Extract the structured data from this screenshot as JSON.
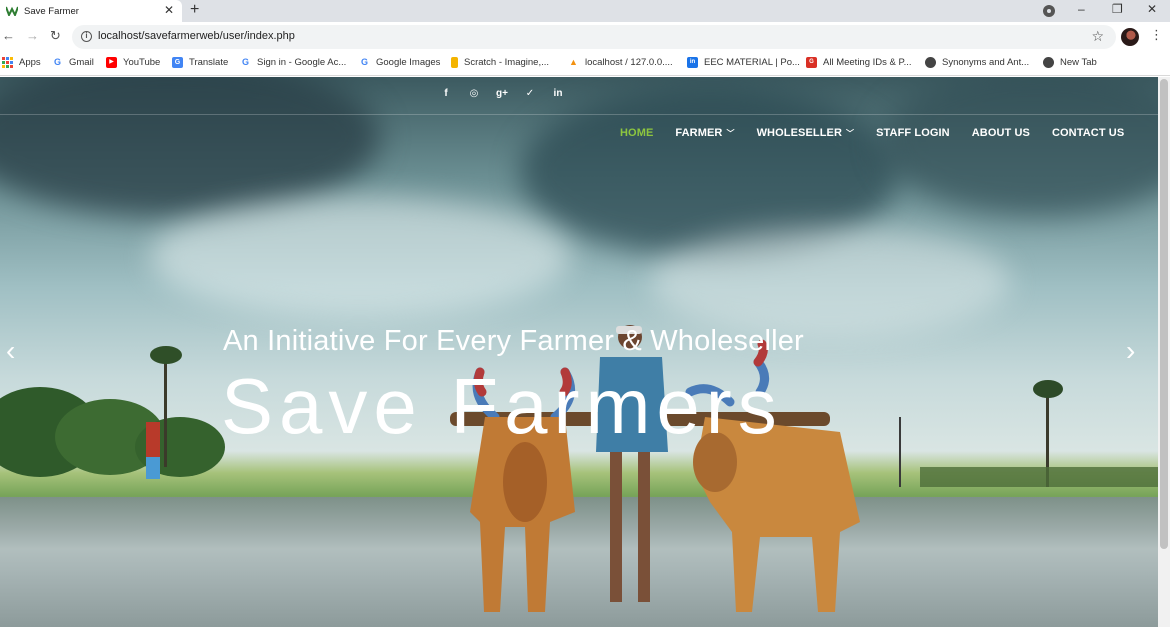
{
  "browser": {
    "tab_title": "Save Farmer",
    "url": "localhost/savefarmerweb/user/index.php",
    "bookmarks": [
      {
        "label": "Apps",
        "icon": "apps-grid-icon",
        "color": "#ea4335"
      },
      {
        "label": "Gmail",
        "icon": "google-icon",
        "color": "#4285f4"
      },
      {
        "label": "YouTube",
        "icon": "youtube-icon",
        "color": "#ff0000"
      },
      {
        "label": "Translate",
        "icon": "translate-icon",
        "color": "#4285f4"
      },
      {
        "label": "Sign in - Google Ac...",
        "icon": "google-icon",
        "color": "#4285f4"
      },
      {
        "label": "Google Images",
        "icon": "google-icon",
        "color": "#4285f4"
      },
      {
        "label": "Scratch - Imagine,...",
        "icon": "bookmark-icon",
        "color": "#f4b400"
      },
      {
        "label": "localhost / 127.0.0....",
        "icon": "phpmyadmin-icon",
        "color": "#f29111"
      },
      {
        "label": "EEC MATERIAL | Po...",
        "icon": "site-icon",
        "color": "#1a73e8"
      },
      {
        "label": "All Meeting IDs & P...",
        "icon": "site-icon",
        "color": "#d93025"
      },
      {
        "label": "Synonyms and Ant...",
        "icon": "globe-icon",
        "color": "#444444"
      },
      {
        "label": "New Tab",
        "icon": "globe-icon",
        "color": "#444444"
      }
    ]
  },
  "site": {
    "nav": [
      {
        "label": "HOME",
        "active": true,
        "dropdown": false
      },
      {
        "label": "FARMER",
        "active": false,
        "dropdown": true
      },
      {
        "label": "WHOLESELLER",
        "active": false,
        "dropdown": true
      },
      {
        "label": "STAFF LOGIN",
        "active": false,
        "dropdown": false
      },
      {
        "label": "ABOUT US",
        "active": false,
        "dropdown": false
      },
      {
        "label": "CONTACT US",
        "active": false,
        "dropdown": false
      }
    ],
    "social": [
      {
        "icon": "facebook-icon",
        "glyph": "f"
      },
      {
        "icon": "instagram-icon",
        "glyph": "◎"
      },
      {
        "icon": "google-plus-icon",
        "glyph": "g+"
      },
      {
        "icon": "twitter-icon",
        "glyph": "✓"
      },
      {
        "icon": "linkedin-icon",
        "glyph": "in"
      }
    ],
    "hero": {
      "tagline": "An Initiative For Every Farmer & Wholeseller",
      "headline": "Save Farmers",
      "prev_arrow": "‹",
      "next_arrow": "›"
    },
    "colors": {
      "accent": "#8dc63f",
      "text": "#ffffff"
    }
  }
}
